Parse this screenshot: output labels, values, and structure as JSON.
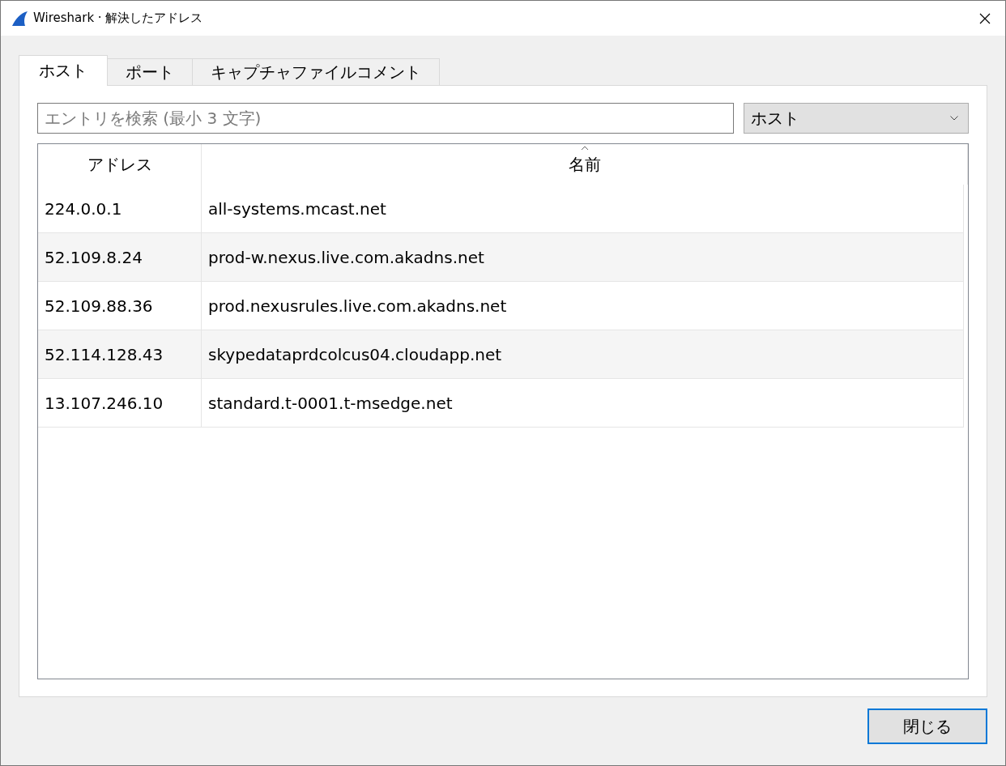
{
  "window": {
    "title": "Wireshark · 解決したアドレス"
  },
  "tabs": [
    {
      "label": "ホスト",
      "selected": true
    },
    {
      "label": "ポート",
      "selected": false
    },
    {
      "label": "キャプチャファイルコメント",
      "selected": false
    }
  ],
  "search": {
    "placeholder": "エントリを検索 (最小 3 文字)"
  },
  "filter_combo": {
    "value": "ホスト"
  },
  "table": {
    "columns": [
      {
        "label": "アドレス",
        "sorted": false
      },
      {
        "label": "名前",
        "sorted": true
      }
    ],
    "rows": [
      [
        "224.0.0.1",
        "all-systems.mcast.net"
      ],
      [
        "52.109.8.24",
        "prod-w.nexus.live.com.akadns.net"
      ],
      [
        "52.109.88.36",
        "prod.nexusrules.live.com.akadns.net"
      ],
      [
        "52.114.128.43",
        "skypedataprdcolcus04.cloudapp.net"
      ],
      [
        "13.107.246.10",
        "standard.t-0001.t-msedge.net"
      ]
    ]
  },
  "buttons": [
    {
      "label": "閉じる",
      "focused": true
    }
  ]
}
